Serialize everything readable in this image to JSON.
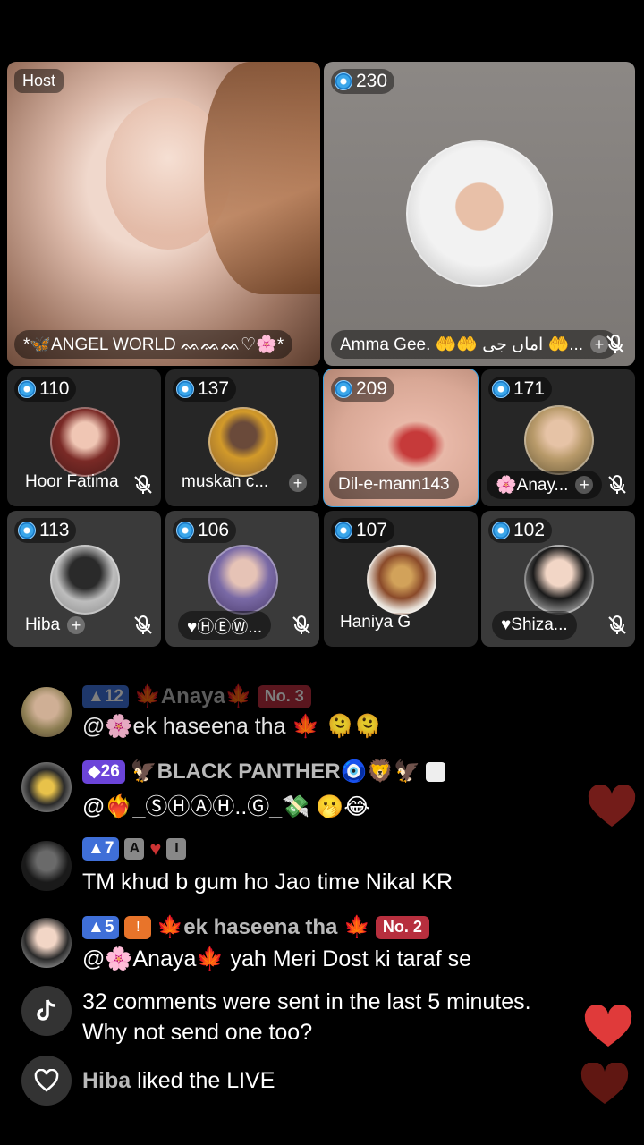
{
  "grid": {
    "host": {
      "badge": "Host",
      "name": "*🦋ANGEL WORLD ᨐᨐᨐ♡🌸*"
    },
    "seats": [
      {
        "count": "230",
        "name": "Amma Gee. 🤲🤲 اماں جی 🤲..."
      },
      {
        "count": "110",
        "name": "Hoor Fatima"
      },
      {
        "count": "137",
        "name": "muskan c..."
      },
      {
        "count": "209",
        "name": "Dil-e-mann143"
      },
      {
        "count": "171",
        "name": "🌸Anay..."
      },
      {
        "count": "113",
        "name": "Hiba"
      },
      {
        "count": "106",
        "name": "♥ⒽⒺⓌ..."
      },
      {
        "count": "107",
        "name": "Haniya G"
      },
      {
        "count": "102",
        "name": "♥Shiza..."
      }
    ]
  },
  "comments": [
    {
      "level": "12",
      "username": "🍁Anaya🍁",
      "rank": "No. 3",
      "message": "@🌸ek haseena tha 🍁 🫠🫠"
    },
    {
      "level": "26",
      "username": "🦅BLACK PANTHER🧿🦁🦅",
      "message": "@❤️‍🔥_ⓈⒽⒶⒽ..Ⓖ_💸 🫢😂"
    },
    {
      "level": "7",
      "tag1": "A",
      "tag2": "I",
      "message": "TM khud b gum ho Jao time Nikal KR"
    },
    {
      "level": "5",
      "username": "🍁ek haseena tha 🍁",
      "rank": "No. 2",
      "message": "@🌸Anaya🍁 yah Meri Dost ki taraf se"
    }
  ],
  "system": {
    "line1": "32 comments were sent in the last 5 minutes.",
    "line2": "Why not send one too?",
    "liked_user": "Hiba",
    "liked_text": " liked the LIVE"
  },
  "colors": {
    "accent_blue": "#3aa6ea",
    "heart_red": "#e03a3a",
    "rank_red": "#b72f3e"
  }
}
